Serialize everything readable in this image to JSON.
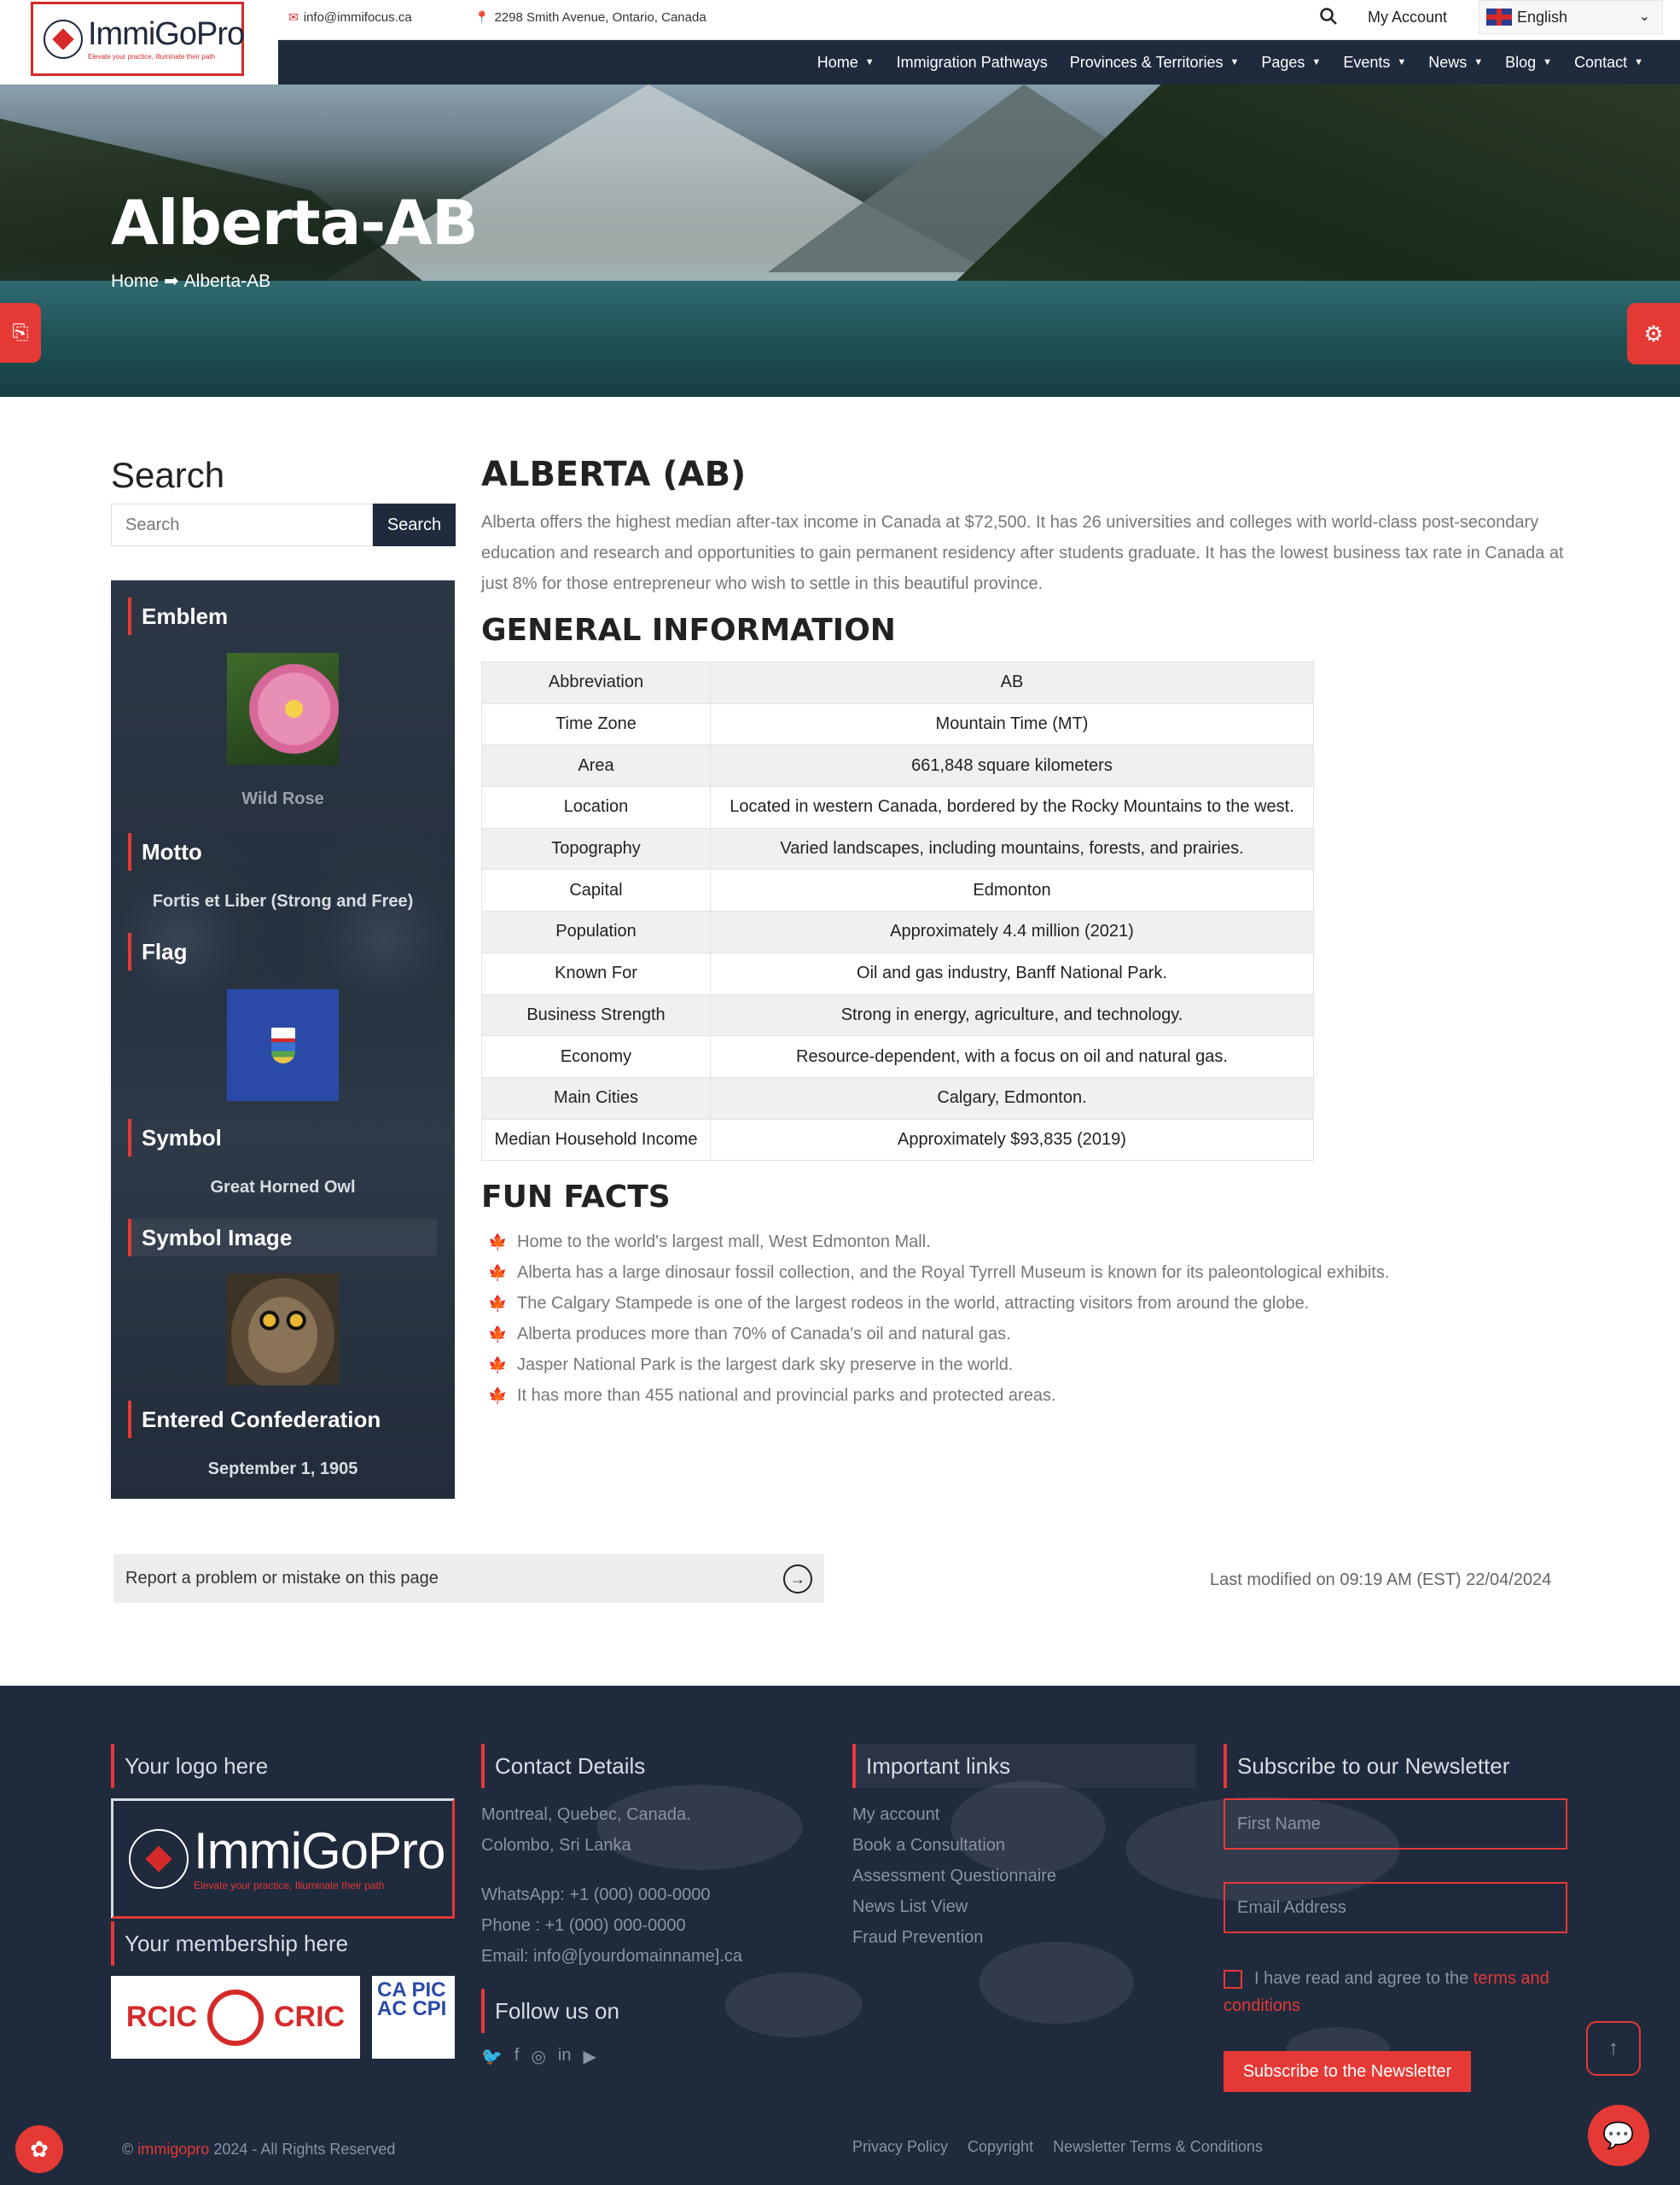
{
  "topbar": {
    "logo_name": "ImmiGoPro",
    "logo_tagline": "Elevate your practice, Illuminate their path",
    "email": "info@immifocus.ca",
    "address": "2298 Smith Avenue, Ontario, Canada",
    "account": "My Account",
    "language": "English"
  },
  "nav": {
    "items": [
      {
        "label": "Home",
        "dropdown": true
      },
      {
        "label": "Immigration Pathways",
        "dropdown": false
      },
      {
        "label": "Provinces & Territories",
        "dropdown": true
      },
      {
        "label": "Pages",
        "dropdown": true
      },
      {
        "label": "Events",
        "dropdown": true
      },
      {
        "label": "News",
        "dropdown": true
      },
      {
        "label": "Blog",
        "dropdown": true
      },
      {
        "label": "Contact",
        "dropdown": true
      }
    ]
  },
  "hero": {
    "title": "Alberta-AB",
    "breadcrumb_home": "Home",
    "breadcrumb_sep": "➡",
    "breadcrumb_current": "Alberta-AB"
  },
  "sidebar": {
    "search_heading": "Search",
    "search_placeholder": "Search",
    "search_button": "Search",
    "emblem_heading": "Emblem",
    "emblem_value": "Wild Rose",
    "motto_heading": "Motto",
    "motto_value": "Fortis et Liber (Strong and Free)",
    "flag_heading": "Flag",
    "symbol_heading": "Symbol",
    "symbol_value": "Great Horned Owl",
    "symbol_image_heading": "Symbol Image",
    "confederation_heading": "Entered Confederation",
    "confederation_value": "September 1, 1905"
  },
  "main": {
    "title": "ALBERTA (AB)",
    "intro": "Alberta offers the highest median after-tax income in Canada at $72,500. It has 26 universities and colleges with world-class post-secondary education and research and opportunities to gain permanent residency after students graduate. It has the lowest business tax rate in Canada at just 8% for those entrepreneur who wish to settle in this beautiful province.",
    "general_heading": "GENERAL INFORMATION",
    "general_rows": [
      {
        "key": "Abbreviation",
        "value": "AB"
      },
      {
        "key": "Time Zone",
        "value": "Mountain Time (MT)"
      },
      {
        "key": "Area",
        "value": "661,848 square kilometers"
      },
      {
        "key": "Location",
        "value": "Located in western Canada, bordered by the Rocky Mountains to the west."
      },
      {
        "key": "Topography",
        "value": "Varied landscapes, including mountains, forests, and prairies."
      },
      {
        "key": "Capital",
        "value": "Edmonton"
      },
      {
        "key": "Population",
        "value": "Approximately 4.4 million (2021)"
      },
      {
        "key": "Known For",
        "value": "Oil and gas industry, Banff National Park."
      },
      {
        "key": "Business Strength",
        "value": "Strong in energy, agriculture, and technology."
      },
      {
        "key": "Economy",
        "value": "Resource-dependent, with a focus on oil and natural gas."
      },
      {
        "key": "Main Cities",
        "value": "Calgary, Edmonton."
      },
      {
        "key": "Median Household Income",
        "value": "Approximately $93,835 (2019)"
      }
    ],
    "fun_heading": "FUN FACTS",
    "fun_facts": [
      "Home to the world's largest mall, West Edmonton Mall.",
      "Alberta has a large dinosaur fossil collection, and the Royal Tyrrell Museum is known for its paleontological exhibits.",
      "The Calgary Stampede is one of the largest rodeos in the world, attracting visitors from around the globe.",
      "Alberta produces more than 70% of Canada's oil and natural gas.",
      "Jasper National Park is the largest dark sky preserve in the world.",
      "It has more than 455 national and provincial parks and protected areas."
    ],
    "report_text": "Report a problem or mistake on this page",
    "last_modified": "Last modified on 09:19 AM (EST) 22/04/2024"
  },
  "footer": {
    "logo_heading": "Your logo here",
    "logo_name": "ImmiGoPro",
    "logo_tagline": "Elevate your practice, Illuminate their path",
    "membership_heading": "Your membership here",
    "rcic_left": "RCIC",
    "rcic_right": "CRIC",
    "capic_text": "CA PIC AC CPI",
    "contact_heading": "Contact Details",
    "contact_lines": [
      "Montreal, Quebec, Canada.",
      "Colombo, Sri Lanka",
      "WhatsApp: +1 (000) 000-0000",
      "Phone : +1 (000) 000-0000",
      "Email: info@[yourdomainname].ca"
    ],
    "follow_heading": "Follow us on",
    "links_heading": "Important links",
    "links": [
      "My account",
      "Book a Consultation",
      "Assessment Questionnaire",
      "News List View",
      "Fraud Prevention"
    ],
    "newsletter_heading": "Subscribe to our Newsletter",
    "first_name_placeholder": "First Name",
    "email_placeholder": "Email Address",
    "consent_text": "I have read and agree to the",
    "consent_link": "terms and conditions",
    "subscribe_button": "Subscribe to the Newsletter",
    "copyright_prefix": "©",
    "copyright_brand": "immigopro",
    "copyright_suffix": "2024 - All Rights Reserved",
    "bottom_links": [
      "Privacy Policy",
      "Copyright",
      "Newsletter Terms & Conditions"
    ]
  }
}
